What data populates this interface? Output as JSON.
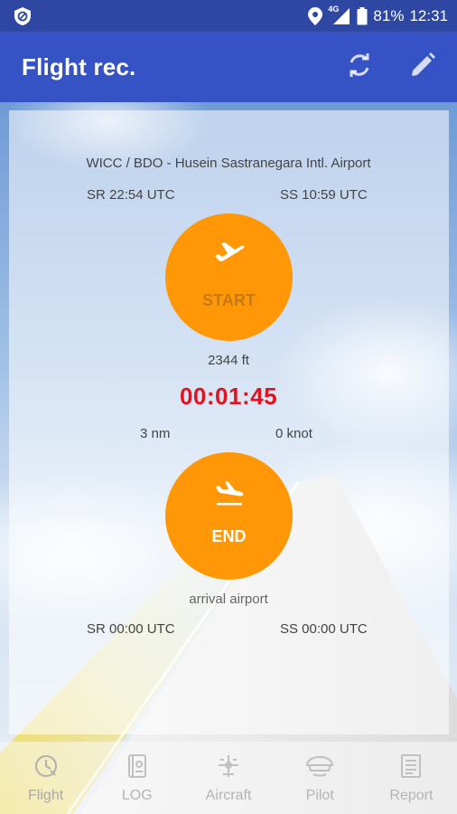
{
  "status_bar": {
    "network": "4G",
    "battery": "81%",
    "time": "12:31",
    "icons": [
      "vpn-icon",
      "location-icon",
      "signal-icon",
      "battery-icon"
    ]
  },
  "app_bar": {
    "title": "Flight rec.",
    "actions": [
      "sync-icon",
      "edit-icon"
    ]
  },
  "departure": {
    "airport": "WICC / BDO - Husein Sastranegara Intl. Airport",
    "sunrise": "SR 22:54 UTC",
    "sunset": "SS 10:59 UTC"
  },
  "start_button": {
    "label": "START",
    "icon": "takeoff-icon"
  },
  "flight": {
    "altitude": "2344 ft",
    "timer": "00:01:45",
    "distance": "3 nm",
    "speed": "0 knot"
  },
  "end_button": {
    "label": "END",
    "icon": "landing-icon"
  },
  "arrival": {
    "airport": "arrival airport",
    "sunrise": "SR 00:00 UTC",
    "sunset": "SS 00:00 UTC"
  },
  "bottom_nav": [
    {
      "label": "Flight",
      "icon": "clock-icon",
      "active": true
    },
    {
      "label": "LOG",
      "icon": "logbook-icon",
      "active": false
    },
    {
      "label": "Aircraft",
      "icon": "aircraft-icon",
      "active": false
    },
    {
      "label": "Pilot",
      "icon": "pilot-cap-icon",
      "active": false
    },
    {
      "label": "Report",
      "icon": "report-icon",
      "active": false
    }
  ],
  "colors": {
    "app_bar": "#3553c4",
    "status_bar": "#2d47a3",
    "accent_button": "#ff9707",
    "timer": "#e8101c"
  }
}
